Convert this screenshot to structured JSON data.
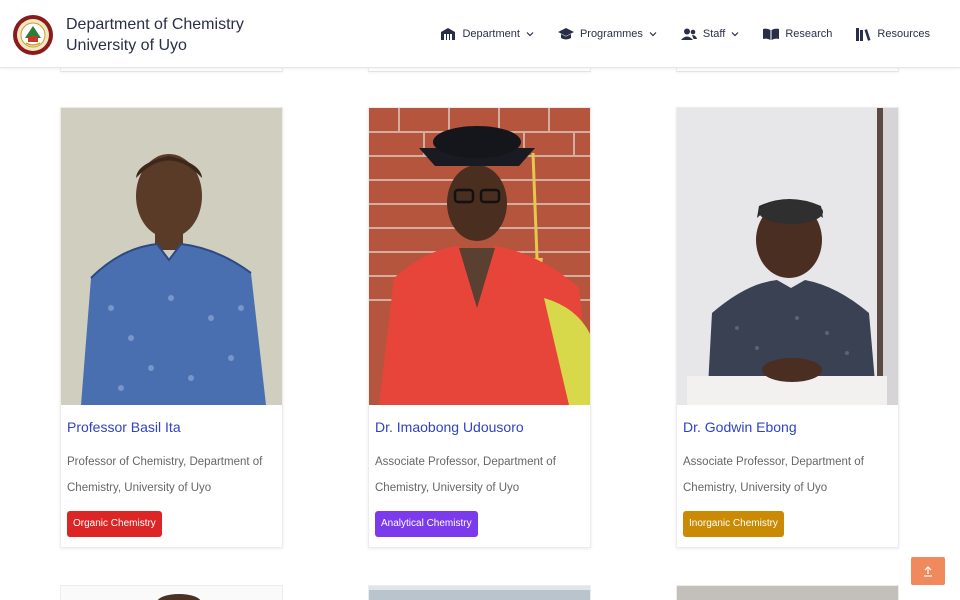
{
  "header": {
    "brand_line1": "Department of Chemistry",
    "brand_line2": "University of Uyo",
    "nav": [
      {
        "label": "Department",
        "icon": "building-icon",
        "dropdown": true
      },
      {
        "label": "Programmes",
        "icon": "graduation-cap-icon",
        "dropdown": true
      },
      {
        "label": "Staff",
        "icon": "users-icon",
        "dropdown": true
      },
      {
        "label": "Research",
        "icon": "book-open-icon",
        "dropdown": false
      },
      {
        "label": "Resources",
        "icon": "library-icon",
        "dropdown": false
      }
    ]
  },
  "staff": [
    {
      "name": "Professor Basil Ita",
      "role": "Professor of Chemistry, Department of Chemistry, University of Uyo",
      "tag": "Organic Chemistry",
      "tag_color": "#dc2626"
    },
    {
      "name": "Dr. Imaobong Udousoro",
      "role": "Associate Professor, Department of Chemistry, University of Uyo",
      "tag": "Analytical Chemistry",
      "tag_color": "#7c3aed"
    },
    {
      "name": "Dr. Godwin Ebong",
      "role": "Associate Professor, Department of Chemistry, University of Uyo",
      "tag": "Inorganic Chemistry",
      "tag_color": "#ca8a04"
    }
  ],
  "colors": {
    "accent": "#2f42c8",
    "nav_text": "#2a2f48",
    "scroll_top": "#f08a5d"
  }
}
